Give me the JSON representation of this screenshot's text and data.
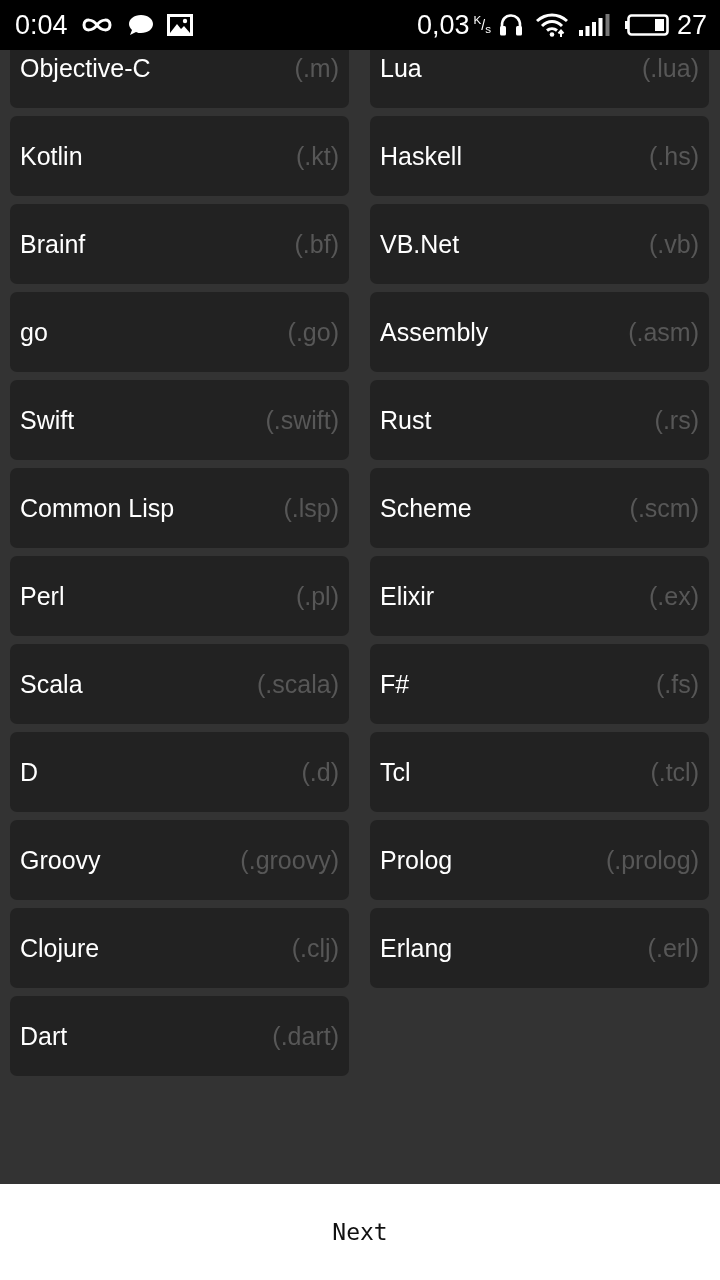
{
  "status_bar": {
    "time": "0:04",
    "network_speed": "0,03",
    "speed_unit": "$^{K}$/$_{s}$",
    "battery": "27"
  },
  "languages": [
    {
      "name": "Objective-C",
      "extension": "(.m)"
    },
    {
      "name": "Lua",
      "extension": "(.lua)"
    },
    {
      "name": "Kotlin",
      "extension": "(.kt)"
    },
    {
      "name": "Haskell",
      "extension": "(.hs)"
    },
    {
      "name": "Brainf",
      "extension": "(.bf)"
    },
    {
      "name": "VB.Net",
      "extension": "(.vb)"
    },
    {
      "name": "go",
      "extension": "(.go)"
    },
    {
      "name": "Assembly",
      "extension": "(.asm)"
    },
    {
      "name": "Swift",
      "extension": "(.swift)"
    },
    {
      "name": "Rust",
      "extension": "(.rs)"
    },
    {
      "name": "Common Lisp",
      "extension": "(.lsp)"
    },
    {
      "name": "Scheme",
      "extension": "(.scm)"
    },
    {
      "name": "Perl",
      "extension": "(.pl)"
    },
    {
      "name": "Elixir",
      "extension": "(.ex)"
    },
    {
      "name": "Scala",
      "extension": "(.scala)"
    },
    {
      "name": "F#",
      "extension": "(.fs)"
    },
    {
      "name": "D",
      "extension": "(.d)"
    },
    {
      "name": "Tcl",
      "extension": "(.tcl)"
    },
    {
      "name": "Groovy",
      "extension": "(.groovy)"
    },
    {
      "name": "Prolog",
      "extension": "(.prolog)"
    },
    {
      "name": "Clojure",
      "extension": "(.clj)"
    },
    {
      "name": "Erlang",
      "extension": "(.erl)"
    },
    {
      "name": "Dart",
      "extension": "(.dart)"
    }
  ],
  "next_button": {
    "label": "Next"
  }
}
